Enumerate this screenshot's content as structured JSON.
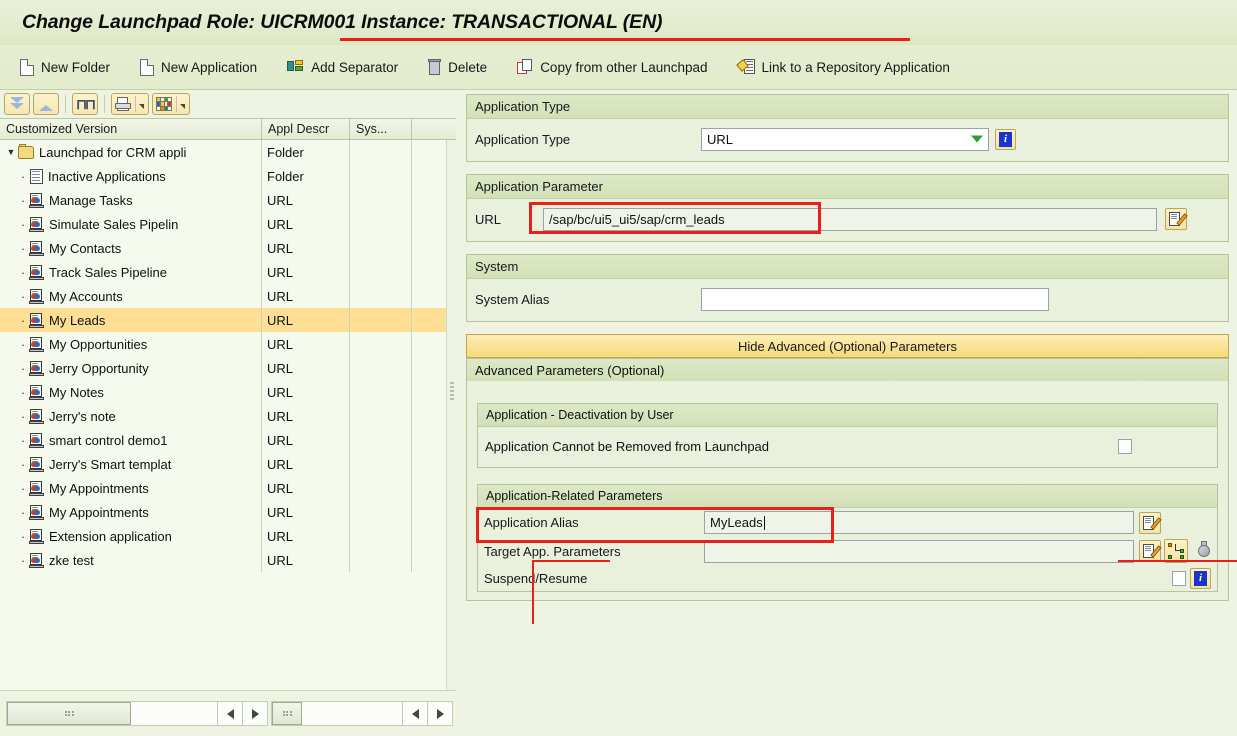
{
  "titlebar": {
    "title": "Change Launchpad Role: UICRM001 Instance: TRANSACTIONAL (EN)"
  },
  "toolbar": {
    "buttons": [
      {
        "label": "New Folder",
        "icon": "page-icon"
      },
      {
        "label": "New Application",
        "icon": "page-icon"
      },
      {
        "label": "Add Separator",
        "icon": "separator-icon"
      },
      {
        "label": "Delete",
        "icon": "trash-icon"
      },
      {
        "label": "Copy from other Launchpad",
        "icon": "copy-icon"
      },
      {
        "label": "Link to a Repository Application",
        "icon": "link-repository-icon"
      }
    ]
  },
  "tree_toolbar": {
    "buttons": [
      {
        "name": "expand-all",
        "icon": "double-chevron-down-icon"
      },
      {
        "name": "collapse-all",
        "icon": "chevron-up-icon"
      },
      {
        "name": "find",
        "icon": "binoculars-icon"
      },
      {
        "name": "print",
        "icon": "printer-icon"
      },
      {
        "name": "layout",
        "icon": "table-layout-icon"
      }
    ]
  },
  "tree": {
    "columns": [
      "Customized Version",
      "Appl Descr",
      "Sys..."
    ],
    "rows": [
      {
        "name": "Launchpad for CRM appli",
        "descr": "Folder",
        "icon": "folder-icon",
        "level": 0,
        "expanded": true,
        "selected": false
      },
      {
        "name": "Inactive Applications",
        "descr": "Folder",
        "icon": "doclist-icon",
        "level": 1,
        "expanded": false,
        "selected": false
      },
      {
        "name": "Manage Tasks",
        "descr": "URL",
        "icon": "app-icon",
        "level": 1,
        "expanded": false,
        "selected": false
      },
      {
        "name": "Simulate Sales Pipelin",
        "descr": "URL",
        "icon": "app-icon",
        "level": 1,
        "expanded": false,
        "selected": false
      },
      {
        "name": "My Contacts",
        "descr": "URL",
        "icon": "app-icon",
        "level": 1,
        "expanded": false,
        "selected": false
      },
      {
        "name": "Track Sales Pipeline",
        "descr": "URL",
        "icon": "app-icon",
        "level": 1,
        "expanded": false,
        "selected": false
      },
      {
        "name": "My Accounts",
        "descr": "URL",
        "icon": "app-icon",
        "level": 1,
        "expanded": false,
        "selected": false
      },
      {
        "name": "My Leads",
        "descr": "URL",
        "icon": "app-icon",
        "level": 1,
        "expanded": false,
        "selected": true
      },
      {
        "name": "My Opportunities",
        "descr": "URL",
        "icon": "app-icon",
        "level": 1,
        "expanded": false,
        "selected": false
      },
      {
        "name": "Jerry Opportunity",
        "descr": "URL",
        "icon": "app-icon",
        "level": 1,
        "expanded": false,
        "selected": false
      },
      {
        "name": "My Notes",
        "descr": "URL",
        "icon": "app-icon",
        "level": 1,
        "expanded": false,
        "selected": false
      },
      {
        "name": "Jerry's note",
        "descr": "URL",
        "icon": "app-icon",
        "level": 1,
        "expanded": false,
        "selected": false
      },
      {
        "name": "smart control demo1",
        "descr": "URL",
        "icon": "app-icon",
        "level": 1,
        "expanded": false,
        "selected": false
      },
      {
        "name": "Jerry's Smart templat",
        "descr": "URL",
        "icon": "app-icon",
        "level": 1,
        "expanded": false,
        "selected": false
      },
      {
        "name": "My Appointments",
        "descr": "URL",
        "icon": "app-icon",
        "level": 1,
        "expanded": false,
        "selected": false
      },
      {
        "name": "My Appointments",
        "descr": "URL",
        "icon": "app-icon",
        "level": 1,
        "expanded": false,
        "selected": false
      },
      {
        "name": "Extension application",
        "descr": "URL",
        "icon": "app-icon",
        "level": 1,
        "expanded": false,
        "selected": false
      },
      {
        "name": "zke test",
        "descr": "URL",
        "icon": "app-icon",
        "level": 1,
        "expanded": false,
        "selected": false
      }
    ]
  },
  "detail": {
    "application_type": {
      "header": "Application Type",
      "label": "Application Type",
      "value": "URL"
    },
    "application_parameter": {
      "header": "Application Parameter",
      "label": "URL",
      "value": "/sap/bc/ui5_ui5/sap/crm_leads"
    },
    "system": {
      "header": "System",
      "label": "System Alias",
      "value": ""
    },
    "advanced_button": "Hide Advanced (Optional) Parameters",
    "advanced": {
      "header": "Advanced Parameters (Optional)",
      "deactivation": {
        "header": "Application - Deactivation by User",
        "label": "Application Cannot be Removed from Launchpad",
        "checked": false
      },
      "related": {
        "header": "Application-Related Parameters",
        "rows": [
          {
            "label": "Application Alias",
            "value": "MyLeads"
          },
          {
            "label": "Target App. Parameters",
            "value": ""
          },
          {
            "label": "Suspend/Resume",
            "value": ""
          }
        ]
      }
    }
  },
  "colors": {
    "accent_red": "#e8201a",
    "selection": "#ffdf96",
    "page_background": "#eef3e2",
    "group_background": "#e9f0dc",
    "advanced_button": "#f9e394"
  }
}
